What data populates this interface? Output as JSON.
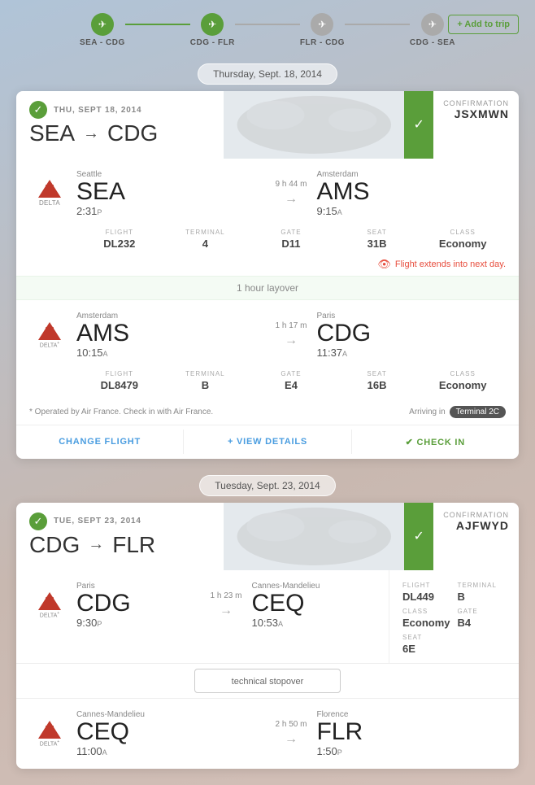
{
  "nav": {
    "add_to_trip": "+ Add to trip",
    "steps": [
      {
        "label": "SEA - CDG",
        "active": true
      },
      {
        "label": "CDG - FLR",
        "active": true
      },
      {
        "label": "FLR - CDG",
        "active": false
      },
      {
        "label": "CDG - SEA",
        "active": false
      }
    ]
  },
  "card1": {
    "date_label": "THU, SEPT 18, 2014",
    "route_from": "SEA",
    "route_to": "CDG",
    "arrow": "→",
    "confirmation_label": "CONFIRMATION",
    "confirmation_code": "JSXMWN",
    "flight1": {
      "airline": "DELTA",
      "departure_city": "Seattle",
      "departure_code": "SEA",
      "departure_time": "2:31",
      "departure_suffix": "P",
      "duration": "9 h 44 m",
      "arrival_city": "Amsterdam",
      "arrival_code": "AMS",
      "arrival_time": "9:15",
      "arrival_suffix": "A",
      "flight_label": "FLIGHT",
      "flight_number": "DL232",
      "terminal_label": "TERMINAL",
      "terminal_value": "4",
      "gate_label": "GATE",
      "gate_value": "D11",
      "seat_label": "SEAT",
      "seat_value": "31B",
      "class_label": "CLASS",
      "class_value": "Economy"
    },
    "warning": "Flight extends into next day.",
    "layover": "1 hour layover",
    "flight2": {
      "airline": "DELTA",
      "departure_city": "Amsterdam",
      "departure_code": "AMS",
      "departure_time": "10:15",
      "departure_suffix": "A",
      "duration": "1 h 17 m",
      "arrival_city": "Paris",
      "arrival_code": "CDG",
      "arrival_time": "11:37",
      "arrival_suffix": "A",
      "flight_label": "FLIGHT",
      "flight_number": "DL8479",
      "terminal_label": "TERMINAL",
      "terminal_value": "B",
      "gate_label": "GATE",
      "gate_value": "E4",
      "seat_label": "SEAT",
      "seat_value": "16B",
      "class_label": "CLASS",
      "class_value": "Economy"
    },
    "note": "* Operated by Air France. Check in with Air France.",
    "arriving_in": "Arriving in",
    "terminal_badge": "Terminal 2C",
    "btn_change": "CHANGE FLIGHT",
    "btn_details": "+ VIEW DETAILS",
    "btn_checkin": "✔ CHECK IN"
  },
  "date2_pill": "Tuesday, Sept. 23, 2014",
  "card2": {
    "date_label": "TUE, SEPT 23, 2014",
    "route_from": "CDG",
    "route_to": "FLR",
    "arrow": "→",
    "confirmation_label": "CONFIRMATION",
    "confirmation_code": "AJFWYD",
    "flight1": {
      "airline": "DELTA",
      "departure_city": "Paris",
      "departure_code": "CDG",
      "departure_time": "9:30",
      "departure_suffix": "P",
      "duration": "1 h 23 m",
      "arrival_city": "Cannes-Mandelieu",
      "arrival_code": "CEQ",
      "arrival_time": "10:53",
      "arrival_suffix": "A",
      "flight_label": "FLIGHT",
      "flight_number": "DL449",
      "terminal_label": "TERMINAL",
      "terminal_value": "B",
      "class_label": "CLASS",
      "class_value": "Economy",
      "gate_label": "GATE",
      "gate_value": "B4",
      "seat_label": "SEAT",
      "seat_value": "6E"
    },
    "stopover": "technical stopover",
    "flight2": {
      "airline": "DELTA",
      "departure_city": "Cannes-Mandelieu",
      "departure_code": "CEQ",
      "departure_time": "11:00",
      "departure_suffix": "A",
      "duration": "2 h 50 m",
      "arrival_city": "Florence",
      "arrival_code": "FLR",
      "arrival_time": "1:50",
      "arrival_suffix": "P"
    }
  },
  "date1_pill": "Thursday, Sept. 18, 2014"
}
